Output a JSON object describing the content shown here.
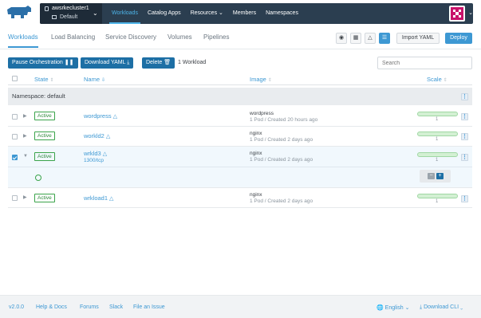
{
  "cluster": {
    "name": "awsrkecluster1",
    "project": "Default"
  },
  "nav": {
    "items": [
      {
        "label": "Workloads",
        "active": true
      },
      {
        "label": "Catalog Apps"
      },
      {
        "label": "Resources",
        "has_dropdown": true
      },
      {
        "label": "Members"
      },
      {
        "label": "Namespaces"
      }
    ]
  },
  "subtabs": [
    {
      "label": "Workloads",
      "active": true
    },
    {
      "label": "Load Balancing"
    },
    {
      "label": "Service Discovery"
    },
    {
      "label": "Volumes"
    },
    {
      "label": "Pipelines"
    }
  ],
  "toolbar": {
    "import_yaml": "Import YAML",
    "deploy": "Deploy",
    "pause": "Pause Orchestration",
    "download_yaml": "Download YAML",
    "delete": "Delete",
    "workload_count": "1 Workload",
    "search_placeholder": "Search"
  },
  "table": {
    "headers": {
      "state": "State",
      "name": "Name",
      "image": "Image",
      "scale": "Scale"
    },
    "namespace_label": "Namespace: default",
    "rows": [
      {
        "state": "Active",
        "name": "wordpress",
        "image": "wordpress",
        "meta": "1 Pod / Created 20 hours ago",
        "scale": "1",
        "checked": false
      },
      {
        "state": "Active",
        "name": "workld2",
        "image": "nginx",
        "meta": "1 Pod / Created 2 days ago",
        "scale": "1",
        "checked": false
      },
      {
        "state": "Active",
        "name": "wrkld3",
        "endpoint": "1300/tcp",
        "image": "nginx",
        "meta": "1 Pod / Created 2 days ago",
        "scale": "1",
        "checked": true,
        "expanded": true
      },
      {
        "state": "Active",
        "name": "wrkload1",
        "image": "nginx",
        "meta": "1 Pod / Created 2 days ago",
        "scale": "1",
        "checked": false
      }
    ]
  },
  "footer": {
    "version": "v2.0.0",
    "help": "Help & Docs",
    "forums": "Forums",
    "slack": "Slack",
    "issue": "File an Issue",
    "language": "English",
    "download_cli": "Download CLI"
  },
  "colors": {
    "accent": "#3d98d3",
    "nav_bg": "#2b3e50",
    "action_btn": "#1d6fa5",
    "active_green": "#3aa34a",
    "avatar": "#c8126b"
  }
}
